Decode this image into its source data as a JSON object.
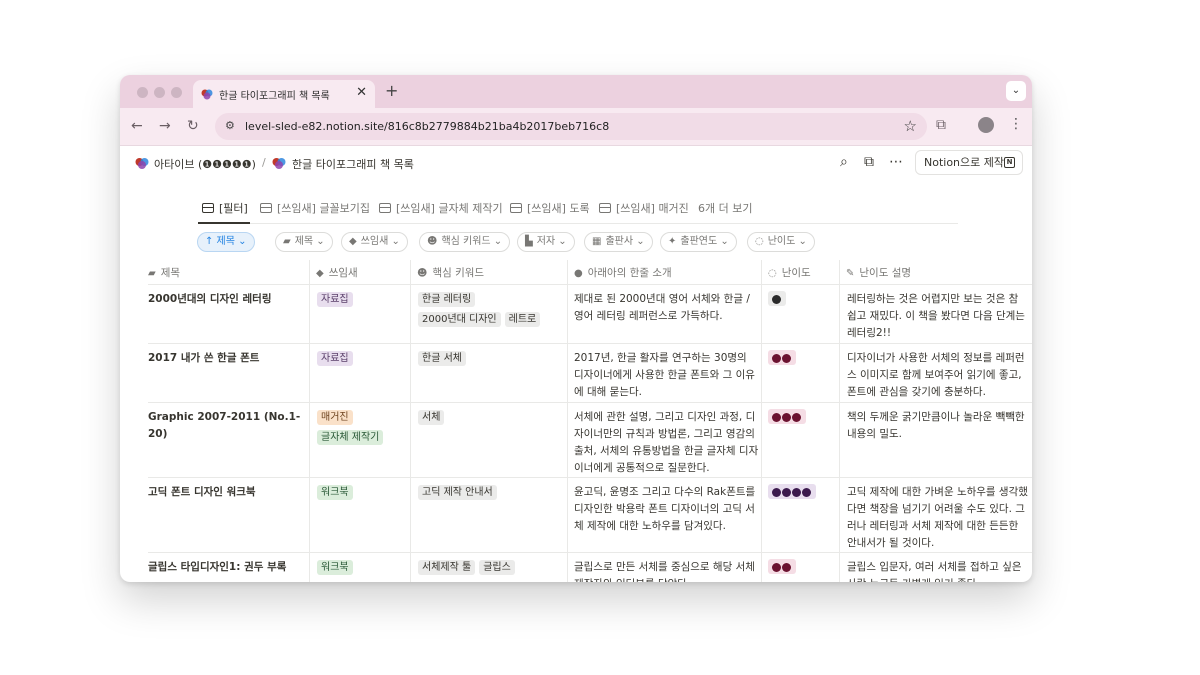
{
  "browser": {
    "tab_title": "한글 타이포그래피 책 목록",
    "new_tab_label": "+",
    "tab_close": "✕",
    "tab_menu": "⌄",
    "url": "level-sled-e82.notion.site/816c8b2779884b21ba4b2017beb716c8",
    "icons": [
      "back-arrow-icon",
      "forward-arrow-icon",
      "reload-icon",
      "site-settings-icon",
      "bookmark-star-icon",
      "extensions-icon",
      "profile-icon",
      "more-vert-icon"
    ]
  },
  "notion": {
    "breadcrumb_workspace": "아타이브 (❶❶❶❶❶)",
    "breadcrumb_separator": "/",
    "breadcrumb_page": "한글 타이포그래피 책 목록",
    "notion_button": "Notion으로 제작",
    "notion_logo": "N"
  },
  "views": [
    "[필터]",
    "[쓰임새] 글꼴보기집",
    "[쓰임새] 글자체 제작기",
    "[쓰임새] 도록",
    "[쓰임새] 매거진",
    "6개 더 보기"
  ],
  "filters": {
    "sort": "↑ 제목 ⌄",
    "chips": [
      "제목 ⌄",
      "쓰임새 ⌄",
      "핵심 키워드 ⌄",
      "저자 ⌄",
      "출판사 ⌄",
      "출판연도 ⌄",
      "난이도 ⌄"
    ]
  },
  "columns": [
    "제목",
    "쓰임새",
    "핵심 키워드",
    "아래아의 한줄 소개",
    "난이도",
    "난이도 설명"
  ],
  "rows": [
    {
      "title": "2000년대의 디자인 레터링",
      "usage": [
        {
          "label": "자료집",
          "color": "purple"
        }
      ],
      "keywords": [
        "한글 레터링",
        "2000년대 디자인",
        "레트로"
      ],
      "intro": "제대로 된 2000년대 영어 서체와 한글 / 영어 레터링 레퍼런스로 가득하다.",
      "difficulty": 1,
      "difficulty_color": "gray",
      "difficulty_desc": "레터링하는 것은 어렵지만 보는 것은 참 쉽고 재밌다. 이 책을 봤다면 다음 단계는 레터링2!!"
    },
    {
      "title": "2017 내가 쓴 한글 폰트",
      "usage": [
        {
          "label": "자료집",
          "color": "purple"
        }
      ],
      "keywords": [
        "한글 서체"
      ],
      "intro": "2017년, 한글 활자를 연구하는 30명의 디자이너에게 사용한 한글 폰트와 그 이유에 대해 묻는다.",
      "difficulty": 2,
      "difficulty_color": "pink",
      "difficulty_desc": "디자이너가 사용한 서체의 정보를 레퍼런스 이미지로 함께 보여주어 읽기에 좋고, 폰트에 관심을 갖기에 충분하다."
    },
    {
      "title": "Graphic 2007-2011 (No.1-20)",
      "usage": [
        {
          "label": "매거진",
          "color": "orange"
        },
        {
          "label": "글자체 제작기",
          "color": "green"
        }
      ],
      "keywords": [
        "서체"
      ],
      "intro": "서체에 관한 설명, 그리고 디자인 과정, 디자이너만의 규칙과 방법론, 그리고 영감의 출처, 서체의 유통방법을 한글 글자체 디자이너에게 공통적으로 질문한다.",
      "difficulty": 3,
      "difficulty_color": "pink",
      "difficulty_desc": "책의 두께운 굵기만큼이나 놀라운 빽빽한 내용의 밀도."
    },
    {
      "title": "고딕 폰트 디자인 워크북",
      "usage": [
        {
          "label": "워크북",
          "color": "green"
        }
      ],
      "keywords": [
        "고딕 제작 안내서"
      ],
      "intro": "윤고딕, 윤명조 그리고 다수의 Rak폰트를 디자인한 박용락 폰트 디자이너의 고딕 서체 제작에 대한 노하우를 담겨있다.",
      "difficulty": 4,
      "difficulty_color": "purple",
      "difficulty_desc": "고딕 제작에 대한 가벼운 노하우를 생각했다면 책장을 넘기기 어려울 수도 있다. 그러나 레터링과 서체 제작에 대한 든든한 안내서가 될 것이다."
    },
    {
      "title": "글립스 타입디자인1: 권두 부록",
      "usage": [
        {
          "label": "워크북",
          "color": "green"
        }
      ],
      "keywords": [
        "서체제작 툴",
        "글립스"
      ],
      "intro": "글립스로 만든 서체를 중심으로 해당 서체 제작자와 인터뷰를 담았다.",
      "difficulty": 2,
      "difficulty_color": "pink",
      "difficulty_desc": "글립스 입문자, 여러 서체를 접하고 싶은 사람 누구든 가볍게 읽기 좋다."
    }
  ]
}
